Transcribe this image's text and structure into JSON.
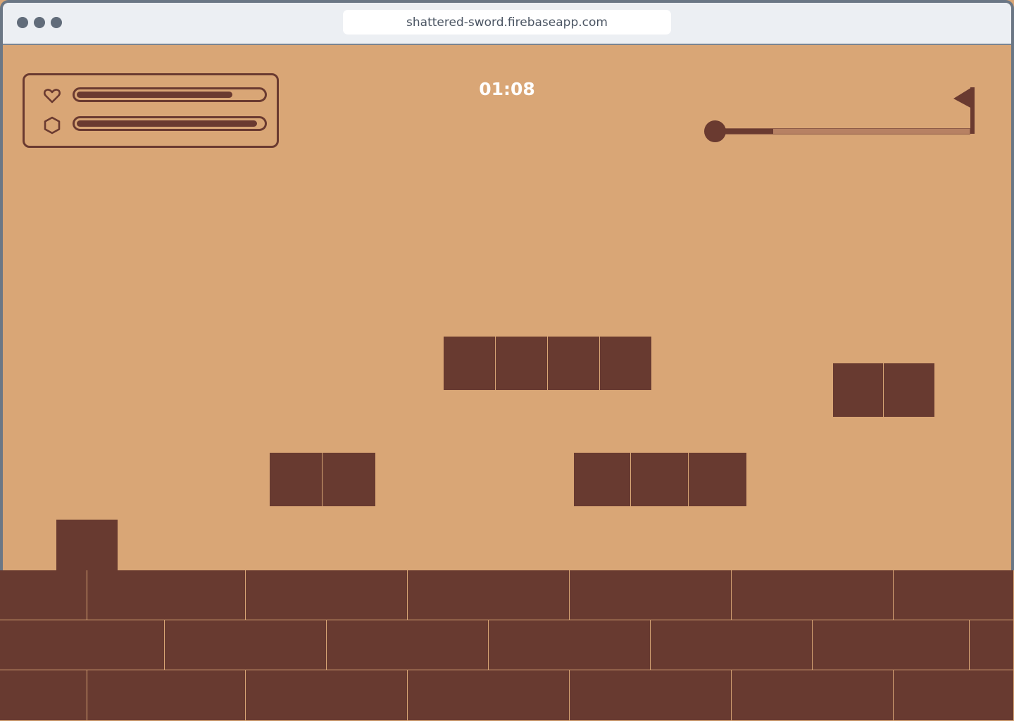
{
  "browser": {
    "url": "shattered-sword.firebaseapp.com",
    "window_buttons": [
      "window-dot",
      "window-dot",
      "window-dot"
    ]
  },
  "hud": {
    "health": {
      "icon": "heart-icon",
      "level": 0.84
    },
    "shield": {
      "icon": "hexagon-icon",
      "level": 0.97
    },
    "timer": "01:08",
    "level_progress": {
      "start_icon": "player-marker-icon",
      "end_icon": "goal-flag-icon",
      "fraction": 0.22
    }
  },
  "colors": {
    "sky": "#D9A676",
    "terrain": "#683A30",
    "track": "#B78163",
    "chrome": "#ECEFF3",
    "timer_text": "#FFFFFF"
  }
}
